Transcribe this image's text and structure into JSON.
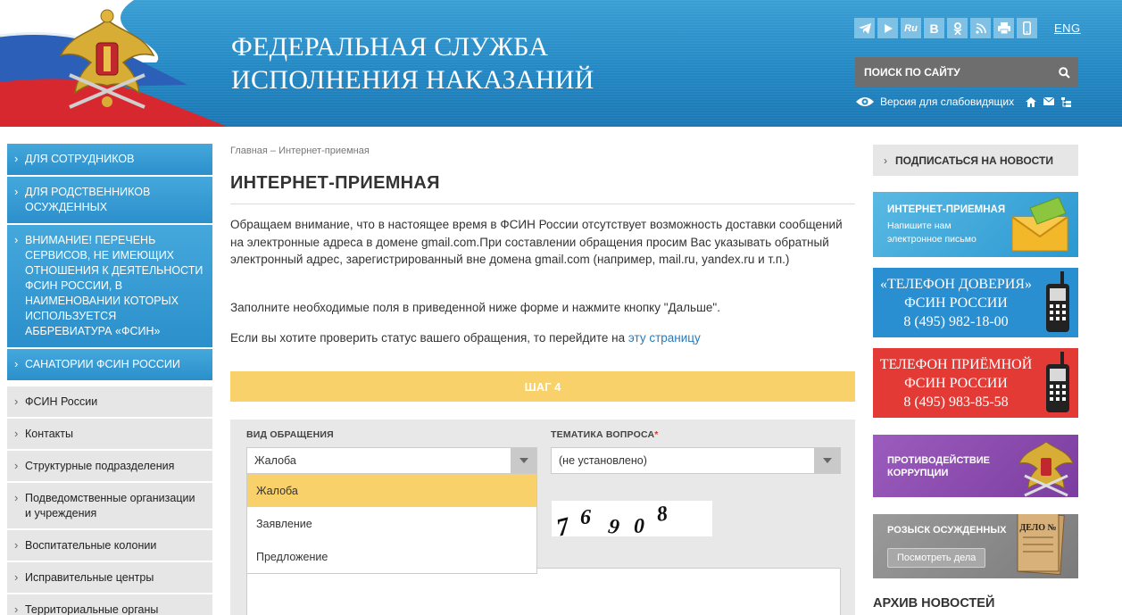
{
  "header": {
    "title_line1": "ФЕДЕРАЛЬНАЯ СЛУЖБА",
    "title_line2": "ИСПОЛНЕНИЯ НАКАЗАНИЙ",
    "social": [
      {
        "icon": "telegram-icon",
        "label": ""
      },
      {
        "icon": "youtube-icon",
        "label": ""
      },
      {
        "icon": "rutube-icon",
        "label": "Ru"
      },
      {
        "icon": "vk-icon",
        "label": "B"
      },
      {
        "icon": "odnoklassniki-icon",
        "label": ""
      },
      {
        "icon": "rss-icon",
        "label": ""
      },
      {
        "icon": "print-icon",
        "label": ""
      },
      {
        "icon": "mobile-icon",
        "label": ""
      }
    ],
    "lang": "ENG",
    "search_placeholder": "ПОИСК ПО САЙТУ",
    "accessibility": "Версия для слабовидящих"
  },
  "sidebar_blue": [
    "ДЛЯ СОТРУДНИКОВ",
    "ДЛЯ РОДСТВЕННИКОВ ОСУЖДЕННЫХ",
    "ВНИМАНИЕ! ПЕРЕЧЕНЬ СЕРВИСОВ, НЕ ИМЕЮЩИХ ОТНОШЕНИЯ К ДЕЯТЕЛЬНОСТИ ФСИН РОССИИ, В НАИМЕНОВАНИИ КОТОРЫХ ИСПОЛЬЗУЕТСЯ АББРЕВИАТУРА «ФСИН»",
    "САНАТОРИИ ФСИН РОССИИ"
  ],
  "sidebar_gray": [
    "ФСИН России",
    "Контакты",
    "Структурные подразделения",
    "Подведомственные организации и учреждения",
    "Воспитательные колонии",
    "Исправительные центры",
    "Территориальные органы"
  ],
  "main": {
    "breadcrumb": "Главная – Интернет-приемная",
    "title": "ИНТЕРНЕТ-ПРИЕМНАЯ",
    "notice": "Обращаем внимание, что в настоящее время в ФСИН России отсутствует возможность доставки сообщений на электронные адреса в домене gmail.com.При составлении обращения просим Вас указывать обратный электронный адрес, зарегистрированный вне домена gmail.com (например, mail.ru, yandex.ru и т.п.)",
    "instruction": "Заполните необходимые поля в приведенной ниже форме и нажмите кнопку \"Дальше\".",
    "status_text": "Если вы хотите проверить статус вашего обращения, то перейдите на",
    "status_link": "эту страницу",
    "step": "ШАГ 4"
  },
  "form": {
    "type_label": "ВИД ОБРАЩЕНИЯ",
    "type_value": "Жалоба",
    "type_options": [
      "Жалоба",
      "Заявление",
      "Предложение"
    ],
    "topic_label": "ТЕМАТИКА ВОПРОСА",
    "topic_required": "*",
    "topic_value": "(не установлено)",
    "captcha_text": "76908"
  },
  "right": {
    "subscribe": "ПОДПИСАТЬСЯ НА НОВОСТИ",
    "reception_title": "ИНТЕРНЕТ-ПРИЕМНАЯ",
    "reception_sub": "Напишите нам электронное письмо",
    "trust_line1": "«ТЕЛЕФОН ДОВЕРИЯ»",
    "trust_line2": "ФСИН РОССИИ",
    "trust_phone": "8 (495) 982-18-00",
    "reception_phone_line1": "ТЕЛЕФОН ПРИЁМНОЙ",
    "reception_phone_line2": "ФСИН РОССИИ",
    "reception_phone": "8 (495) 983-85-58",
    "corruption_line1": "ПРОТИВОДЕЙСТВИЕ",
    "corruption_line2": "КОРРУПЦИИ",
    "wanted_title": "РОЗЫСК ОСУЖДЕННЫХ",
    "wanted_button": "Посмотреть дела",
    "folder_label": "ДЕЛО №",
    "archive": "АРХИВ НОВОСТЕЙ"
  },
  "colors": {
    "header_blue": "#2488c4",
    "sidebar_blue": "#2b8fcb",
    "step_yellow": "#f9d16b",
    "trust_blue": "#2a8fd0",
    "phone_red": "#e33a35",
    "corruption_purple": "#7b3d9f",
    "wanted_gray": "#7b7b7b"
  }
}
